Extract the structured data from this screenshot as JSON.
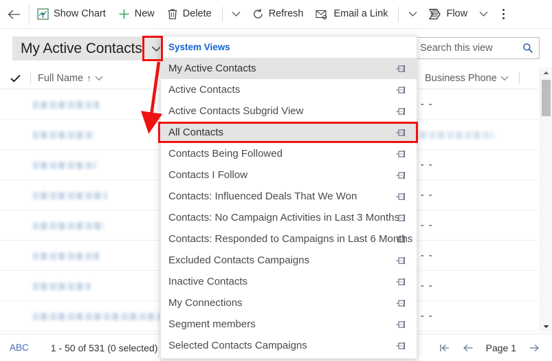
{
  "commandbar": {
    "back_icon": "arrow-left-icon",
    "buttons": [
      {
        "id": "show-chart",
        "label": "Show Chart",
        "icon": "chart-icon"
      },
      {
        "id": "new",
        "label": "New",
        "icon": "plus-icon"
      },
      {
        "id": "delete",
        "label": "Delete",
        "icon": "trash-icon"
      },
      {
        "id": "refresh",
        "label": "Refresh",
        "icon": "refresh-icon"
      },
      {
        "id": "email-a-link",
        "label": "Email a Link",
        "icon": "email-link-icon"
      },
      {
        "id": "flow",
        "label": "Flow",
        "icon": "flow-icon"
      }
    ],
    "overflow_icon": "more-vertical-icon",
    "chevron_icon": "chevron-down-icon"
  },
  "view": {
    "title": "My Active Contacts",
    "chevron_icon": "chevron-down-icon"
  },
  "search": {
    "placeholder": "Search this view",
    "value": "",
    "icon": "search-icon"
  },
  "grid": {
    "header": {
      "select_all_icon": "checkmark-icon",
      "columns": [
        {
          "id": "full-name",
          "label": "Full Name",
          "sort": "↑",
          "chevron": "⌄"
        },
        {
          "id": "business-phone",
          "label": "Business Phone",
          "chevron": "⌄"
        }
      ]
    },
    "rows": [
      {
        "name_w": 96,
        "b_w": 0,
        "c_dash": "- - -"
      },
      {
        "name_w": 88,
        "b_w": 0,
        "c_dash": ""
      },
      {
        "name_w": 92,
        "b_w": 0,
        "c_dash": "- - -"
      },
      {
        "name_w": 108,
        "b_w": 0,
        "c_dash": "- - -"
      },
      {
        "name_w": 104,
        "b_w": 0,
        "c_dash": "- - -"
      },
      {
        "name_w": 96,
        "b_w": 0,
        "c_dash": "- - -"
      },
      {
        "name_w": 84,
        "b_w": 0,
        "c_dash": "- - -"
      },
      {
        "name_w": 190,
        "b_w": 0,
        "c_dash": "- - -"
      },
      {
        "name_w": 78,
        "b_w": 0,
        "c_dash": "- - -"
      }
    ],
    "empty_value": "- - -"
  },
  "flyout": {
    "header": "System Views",
    "pin_icon": "pin-icon",
    "items": [
      {
        "label": "My Active Contacts",
        "state": "selected"
      },
      {
        "label": "Active Contacts",
        "state": "normal"
      },
      {
        "label": "Active Contacts Subgrid View",
        "state": "normal"
      },
      {
        "label": "All Contacts",
        "state": "hover"
      },
      {
        "label": "Contacts Being Followed",
        "state": "normal"
      },
      {
        "label": "Contacts I Follow",
        "state": "normal"
      },
      {
        "label": "Contacts: Influenced Deals That We Won",
        "state": "normal"
      },
      {
        "label": "Contacts: No Campaign Activities in Last 3 Months",
        "state": "normal"
      },
      {
        "label": "Contacts: Responded to Campaigns in Last 6 Months",
        "state": "normal"
      },
      {
        "label": "Excluded Contacts Campaigns",
        "state": "normal"
      },
      {
        "label": "Inactive Contacts",
        "state": "normal"
      },
      {
        "label": "My Connections",
        "state": "normal"
      },
      {
        "label": "Segment members",
        "state": "normal"
      },
      {
        "label": "Selected Contacts Campaigns",
        "state": "normal"
      }
    ]
  },
  "statusbar": {
    "abc_label": "ABC",
    "record_count": "1 - 50 of 531 (0 selected)",
    "page_label": "Page 1",
    "first_page_icon": "page-first-icon",
    "prev_page_icon": "arrow-left-icon",
    "next_page_icon": "arrow-right-icon"
  },
  "annotations": {
    "accent_color": "#ee1111",
    "chevron_box": "highlight-view-selector-chevron",
    "item_box": "highlight-all-contacts-item",
    "arrow": "arrow-from-chevron-to-all-contacts"
  }
}
